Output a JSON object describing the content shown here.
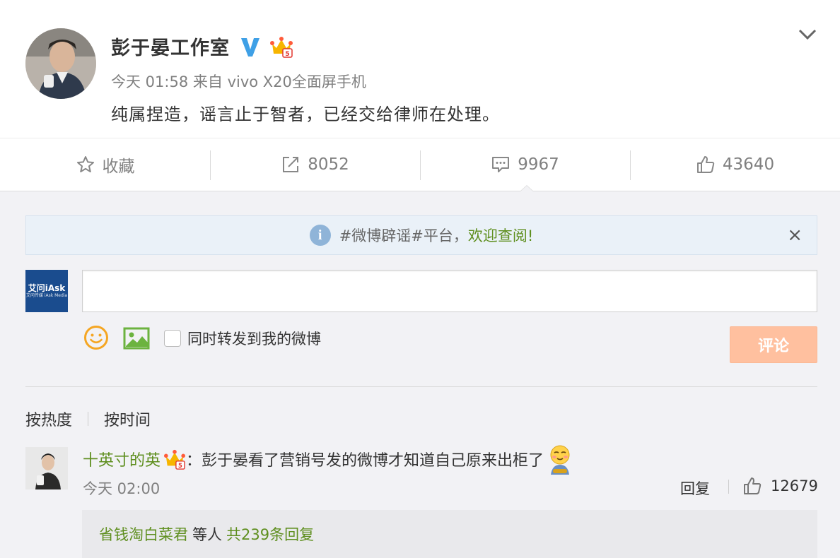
{
  "post": {
    "author": "彭于晏工作室",
    "verified_icon": "verified-v-icon",
    "badge_icon": "member-crown-icon",
    "time": "今天 01:58",
    "source_prefix": "来自",
    "source": "vivo X20全面屏手机",
    "text": "纯属捏造，谣言止于智者，已经交给律师在处理。"
  },
  "actions": {
    "favorite_label": "收藏",
    "repost_count": "8052",
    "comment_count": "9967",
    "like_count": "43640"
  },
  "notice": {
    "prefix": "#微博辟谣#平台，",
    "link": "欢迎查阅!",
    "close": "×"
  },
  "composer": {
    "input_value": "",
    "my_avatar_logo": "艾问iAsk",
    "my_avatar_sub": "艾问传媒 iAsk Media",
    "forward_label": "同时转发到我的微博",
    "submit_label": "评论"
  },
  "sort": {
    "by_hot": "按热度",
    "by_time": "按时间"
  },
  "comments": [
    {
      "user": "十英寸的英",
      "colon": "：",
      "text": "彭于晏看了营销号发的微博才知道自己原来出柜了",
      "time": "今天 02:00",
      "reply_label": "回复",
      "likes": "12679",
      "replies": {
        "users": "省钱淘白菜君",
        "middle": "等人",
        "total": "共239条回复"
      }
    }
  ],
  "colors": {
    "link_green": "#5f8f1f",
    "submit_bg": "#ffc09f",
    "panel_bg": "#f2f2f5",
    "verified_blue": "#3fa0e6"
  }
}
